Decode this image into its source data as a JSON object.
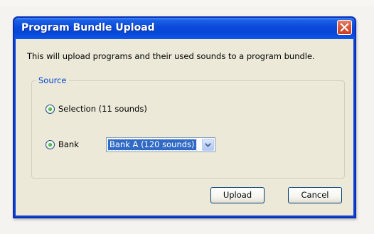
{
  "dialog": {
    "title": "Program Bundle Upload",
    "message": "This will upload programs and their used sounds to a program bundle.",
    "source_group": {
      "legend": "Source",
      "options": [
        {
          "label": "Selection (11 sounds)",
          "selected": true
        },
        {
          "label": "Bank",
          "selected": true
        }
      ],
      "bank_select": {
        "value": "Bank A (120 sounds)"
      }
    },
    "buttons": {
      "upload_label": "Upload",
      "cancel_label": "Cancel"
    }
  },
  "icons": {
    "close": "close-icon",
    "dropdown": "chevron-down-icon"
  },
  "colors": {
    "titlebar": "#0a4ad9",
    "dialog_bg": "#ece9d8",
    "close_button": "#d9573a",
    "legend_text": "#0046d5",
    "selection_highlight": "#316ac5",
    "radio_dot": "#2ea12e"
  }
}
